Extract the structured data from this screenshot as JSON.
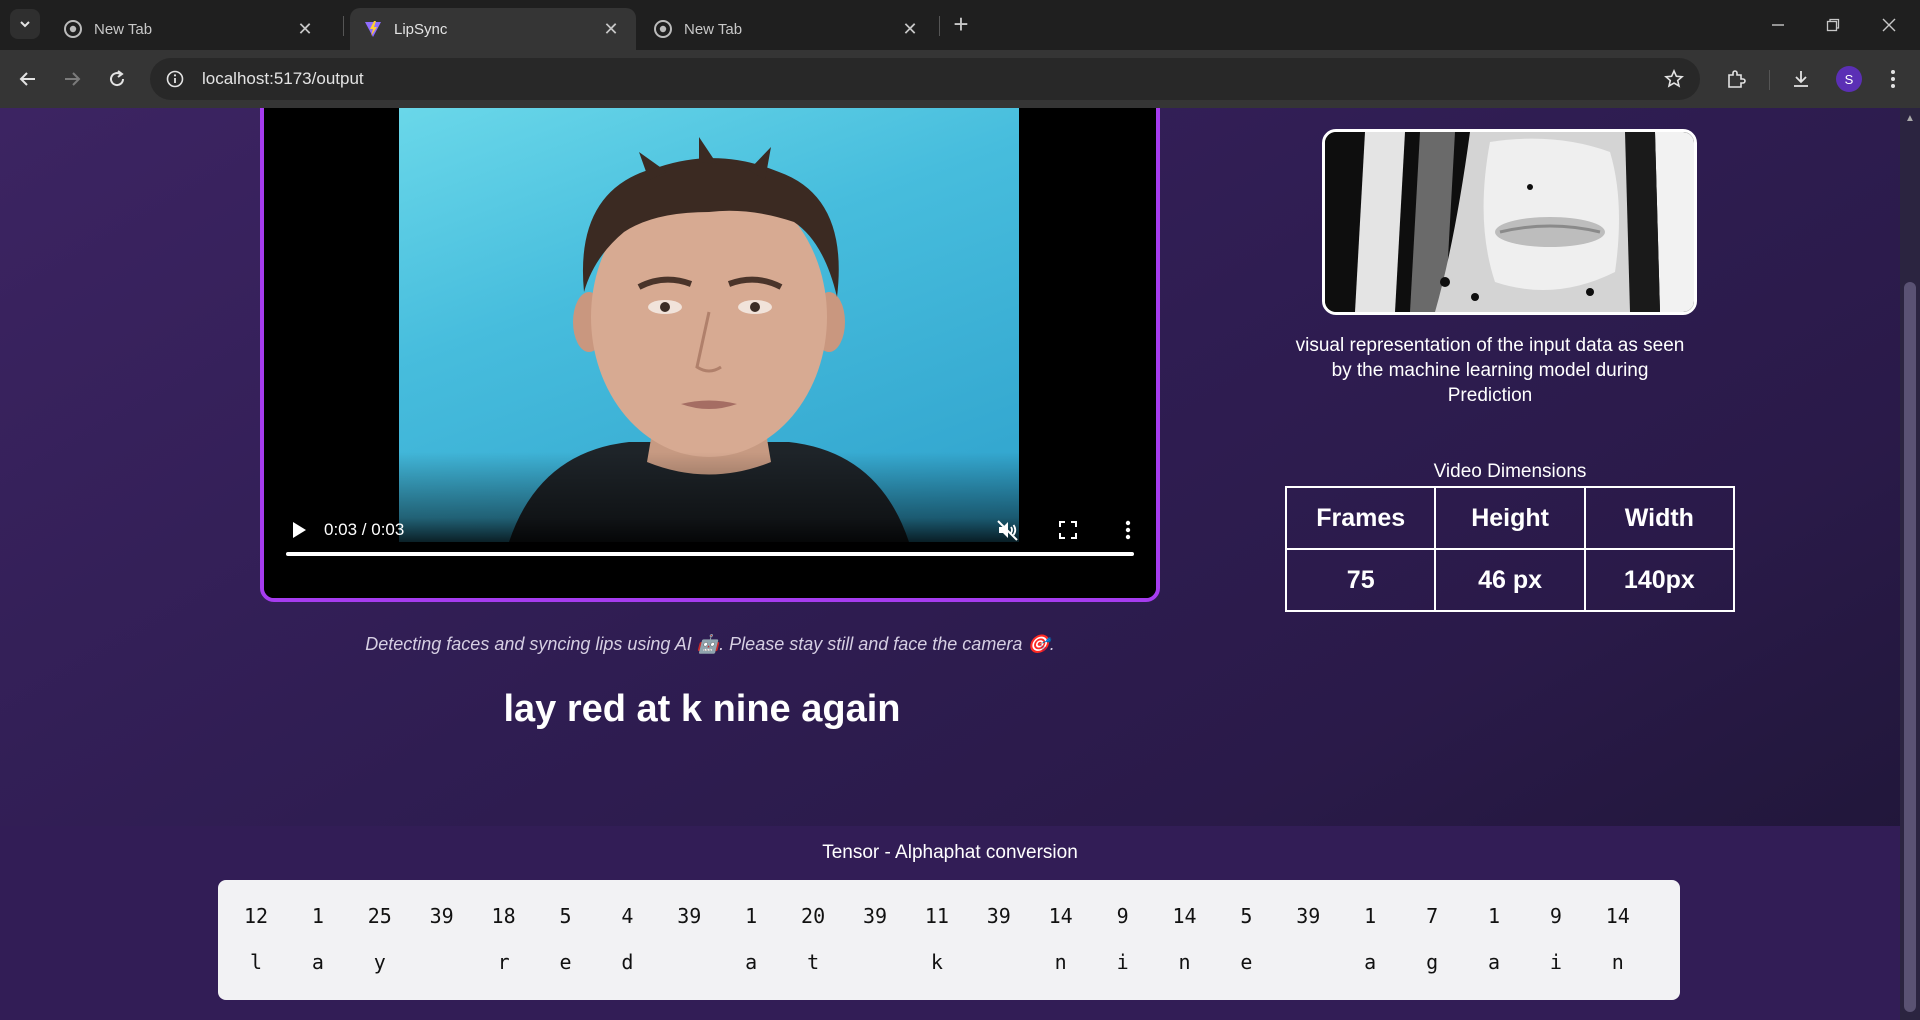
{
  "browser": {
    "tabs": [
      {
        "title": "New Tab",
        "favicon": "chrome-icon",
        "active": false
      },
      {
        "title": "LipSync",
        "favicon": "vite-icon",
        "active": true
      },
      {
        "title": "New Tab",
        "favicon": "chrome-icon",
        "active": false
      }
    ],
    "url": "localhost:5173/output",
    "profile_initial": "S"
  },
  "video": {
    "time": "0:03 / 0:03",
    "progress": 1.0,
    "muted": true
  },
  "caption": "Detecting faces and syncing lips using AI 🤖. Please stay still and face the camera 🎯.",
  "prediction": "lay red at k nine again",
  "mouth_panel": {
    "description": "visual representation of the input data as seen by the machine learning model during Prediction"
  },
  "dimensions": {
    "title": "Video Dimensions",
    "headers": [
      "Frames",
      "Height",
      "Width"
    ],
    "values": [
      "75",
      "46 px",
      "140px"
    ]
  },
  "tensor": {
    "title": "Tensor - Alphaphat conversion",
    "numbers": [
      "12",
      "1",
      "25",
      "39",
      "18",
      "5",
      "4",
      "39",
      "1",
      "20",
      "39",
      "11",
      "39",
      "14",
      "9",
      "14",
      "5",
      "39",
      "1",
      "7",
      "1",
      "9",
      "14"
    ],
    "letters": [
      "l",
      "a",
      "y",
      "",
      "r",
      "e",
      "d",
      "",
      "a",
      "t",
      "",
      "k",
      "",
      "n",
      "i",
      "n",
      "e",
      "",
      "a",
      "g",
      "a",
      "i",
      "n"
    ]
  },
  "colors": {
    "accent": "#a63cf0",
    "page_bg": "#2f1d52",
    "band_bg": "#321d56"
  }
}
